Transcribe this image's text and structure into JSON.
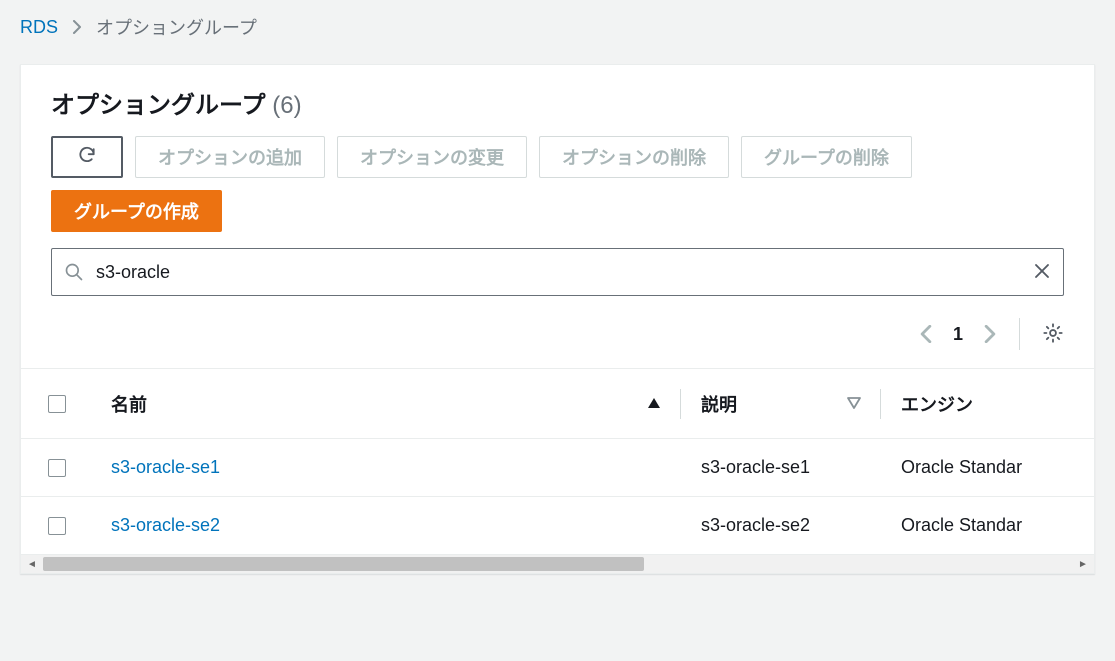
{
  "breadcrumb": {
    "root": "RDS",
    "current": "オプショングループ"
  },
  "header": {
    "title": "オプショングループ",
    "count": "(6)"
  },
  "toolbar": {
    "refresh_aria": "refresh",
    "add_option": "オプションの追加",
    "modify_option": "オプションの変更",
    "delete_option": "オプションの削除",
    "delete_group": "グループの削除",
    "create_group": "グループの作成"
  },
  "search": {
    "value": "s3-oracle",
    "placeholder": ""
  },
  "pager": {
    "page": "1"
  },
  "columns": {
    "name": "名前",
    "description": "説明",
    "engine": "エンジン"
  },
  "rows": [
    {
      "name": "s3-oracle-se1",
      "description": "s3-oracle-se1",
      "engine": "Oracle Standar"
    },
    {
      "name": "s3-oracle-se2",
      "description": "s3-oracle-se2",
      "engine": "Oracle Standar"
    }
  ]
}
